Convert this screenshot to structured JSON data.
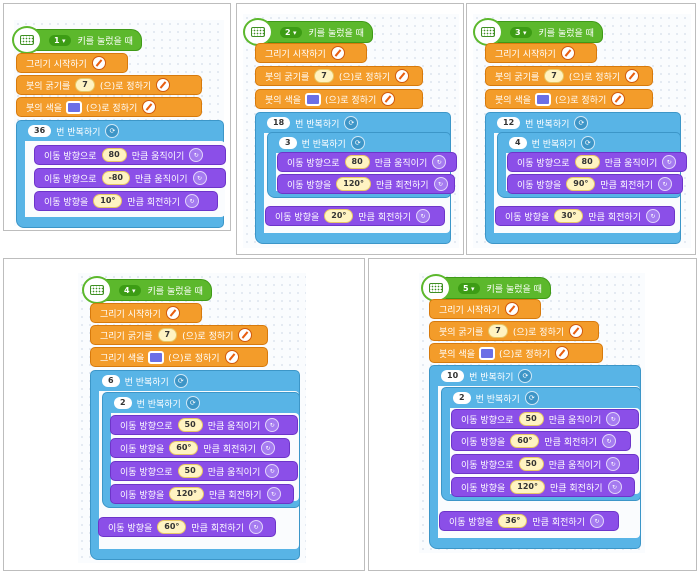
{
  "panels": [
    {
      "key": "1",
      "event": "키를 눌렀을 때",
      "pen_start": "그리기 시작하기",
      "thickness": {
        "pre": "붓의 굵기를",
        "value": "7",
        "post": "(으)로 정하기"
      },
      "color": {
        "pre": "붓의 색을",
        "post": "(으)로 정하기",
        "swatch": "#6b6fe6"
      },
      "loop": {
        "count": "36",
        "label": "번 반복하기"
      },
      "inner": [
        {
          "pre": "이동 방향으로",
          "value": "80",
          "post": "만큼 움직이기"
        },
        {
          "pre": "이동 방향으로",
          "value": "-80",
          "post": "만큼 움직이기"
        },
        {
          "pre": "이동 방향을",
          "value": "10°",
          "post": "만큼 회전하기"
        }
      ]
    },
    {
      "key": "2",
      "event": "키를 눌렀을 때",
      "pen_start": "그리기 시작하기",
      "thickness": {
        "pre": "붓의 굵기를",
        "value": "7",
        "post": "(으)로 정하기"
      },
      "color": {
        "pre": "붓의 색을",
        "post": "(으)로 정하기",
        "swatch": "#6b6fe6"
      },
      "loop": {
        "count": "18",
        "label": "번 반복하기"
      },
      "loop2": {
        "count": "3",
        "label": "번 반복하기"
      },
      "inner2": [
        {
          "pre": "이동 방향으로",
          "value": "80",
          "post": "만큼 움직이기"
        },
        {
          "pre": "이동 방향을",
          "value": "120°",
          "post": "만큼 회전하기"
        }
      ],
      "after": {
        "pre": "이동 방향을",
        "value": "20°",
        "post": "만큼 회전하기"
      }
    },
    {
      "key": "3",
      "event": "키를 눌렀을 때",
      "pen_start": "그리기 시작하기",
      "thickness": {
        "pre": "붓의 굵기를",
        "value": "7",
        "post": "(으)로 정하기"
      },
      "color": {
        "pre": "붓의 색을",
        "post": "(으)로 정하기",
        "swatch": "#6b6fe6"
      },
      "loop": {
        "count": "12",
        "label": "번 반복하기"
      },
      "loop2": {
        "count": "4",
        "label": "번 반복하기"
      },
      "inner2": [
        {
          "pre": "이동 방향으로",
          "value": "80",
          "post": "만큼 움직이기"
        },
        {
          "pre": "이동 방향을",
          "value": "90°",
          "post": "만큼 회전하기"
        }
      ],
      "after": {
        "pre": "이동 방향을",
        "value": "30°",
        "post": "만큼 회전하기"
      }
    },
    {
      "key": "4",
      "event": "키를 눌렀을 때",
      "pen_start": "그리기 시작하기",
      "thickness": {
        "pre": "그리기 굵기를",
        "value": "7",
        "post": "(으)로 정하기"
      },
      "color": {
        "pre": "그리기 색을",
        "post": "(으)로 정하기",
        "swatch": "#6b6fe6"
      },
      "loop": {
        "count": "6",
        "label": "번 반복하기"
      },
      "loop2": {
        "count": "2",
        "label": "번 반복하기"
      },
      "inner2": [
        {
          "pre": "이동 방향으로",
          "value": "50",
          "post": "만큼 움직이기"
        },
        {
          "pre": "이동 방향을",
          "value": "60°",
          "post": "만큼 회전하기"
        },
        {
          "pre": "이동 방향으로",
          "value": "50",
          "post": "만큼 움직이기"
        },
        {
          "pre": "이동 방향을",
          "value": "120°",
          "post": "만큼 회전하기"
        }
      ],
      "after": {
        "pre": "이동 방향을",
        "value": "60°",
        "post": "만큼 회전하기"
      }
    },
    {
      "key": "5",
      "event": "키를 눌렀을 때",
      "pen_start": "그리기 시작하기",
      "thickness": {
        "pre": "붓의 굵기를",
        "value": "7",
        "post": "(으)로 정하기"
      },
      "color": {
        "pre": "붓의 색을",
        "post": "(으)로 정하기",
        "swatch": "#6b6fe6"
      },
      "loop": {
        "count": "10",
        "label": "번 반복하기"
      },
      "loop2": {
        "count": "2",
        "label": "번 반복하기"
      },
      "inner2": [
        {
          "pre": "이동 방향으로",
          "value": "50",
          "post": "만큼 움직이기"
        },
        {
          "pre": "이동 방향을",
          "value": "60°",
          "post": "만큼 회전하기"
        },
        {
          "pre": "이동 방향으로",
          "value": "50",
          "post": "만큼 움직이기"
        },
        {
          "pre": "이동 방향을",
          "value": "120°",
          "post": "만큼 회전하기"
        }
      ],
      "after": {
        "pre": "이동 방향을",
        "value": "36°",
        "post": "만큼 회전하기"
      }
    }
  ],
  "icons": {
    "hat": "keyboard-icon",
    "pen": "pen-icon",
    "motion": "motion-icon",
    "repeat": "repeat-icon"
  },
  "colors": {
    "event": "#5cb82c",
    "pen": "#f39c2a",
    "motion": "#8b4fe8",
    "repeat": "#58b4e6"
  }
}
